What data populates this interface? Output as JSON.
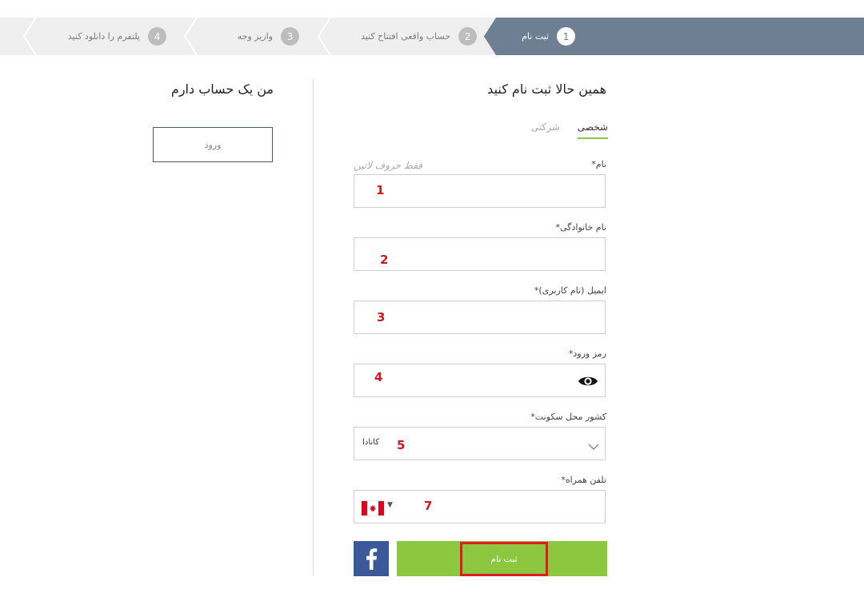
{
  "stepper": {
    "steps": [
      {
        "num": "1",
        "label": "ثبت نام"
      },
      {
        "num": "2",
        "label": "حساب واقعی افتتاح کنید"
      },
      {
        "num": "3",
        "label": "واریز وجه"
      },
      {
        "num": "4",
        "label": "پلتفرم را دانلود کنید"
      }
    ],
    "active_index": 0,
    "active_color": "#6f7f93"
  },
  "signup": {
    "title": "همین حالا ثبت نام کنید",
    "tabs": [
      {
        "label": "شخصی",
        "active": true
      },
      {
        "label": "شرکتی",
        "active": false
      }
    ],
    "first_name": {
      "label": "نام*",
      "hint": "فقط حروف لاتین",
      "value": ""
    },
    "last_name": {
      "label": "نام خانوادگی*",
      "value": ""
    },
    "email": {
      "label": "ایمیل (نام کاربری)*",
      "value": ""
    },
    "password": {
      "label": "رمز ورود*",
      "value": "",
      "icon": "eye-icon"
    },
    "country": {
      "label": "کشور محل سکونت*",
      "value": "کانادا",
      "icon": "chevron-down-icon"
    },
    "phone": {
      "label": "تلفن همراه*",
      "value": "",
      "flag": "canada-flag-icon"
    },
    "submit_label": "ثبت نام",
    "facebook_icon": "facebook-icon"
  },
  "annotations": [
    "1",
    "2",
    "3",
    "4",
    "5",
    "7"
  ],
  "login": {
    "title": "من یک حساب دارم",
    "button_label": "ورود"
  },
  "colors": {
    "accent_green": "#8dc63f",
    "facebook_blue": "#3b5998",
    "highlight_red": "#e01b22"
  }
}
